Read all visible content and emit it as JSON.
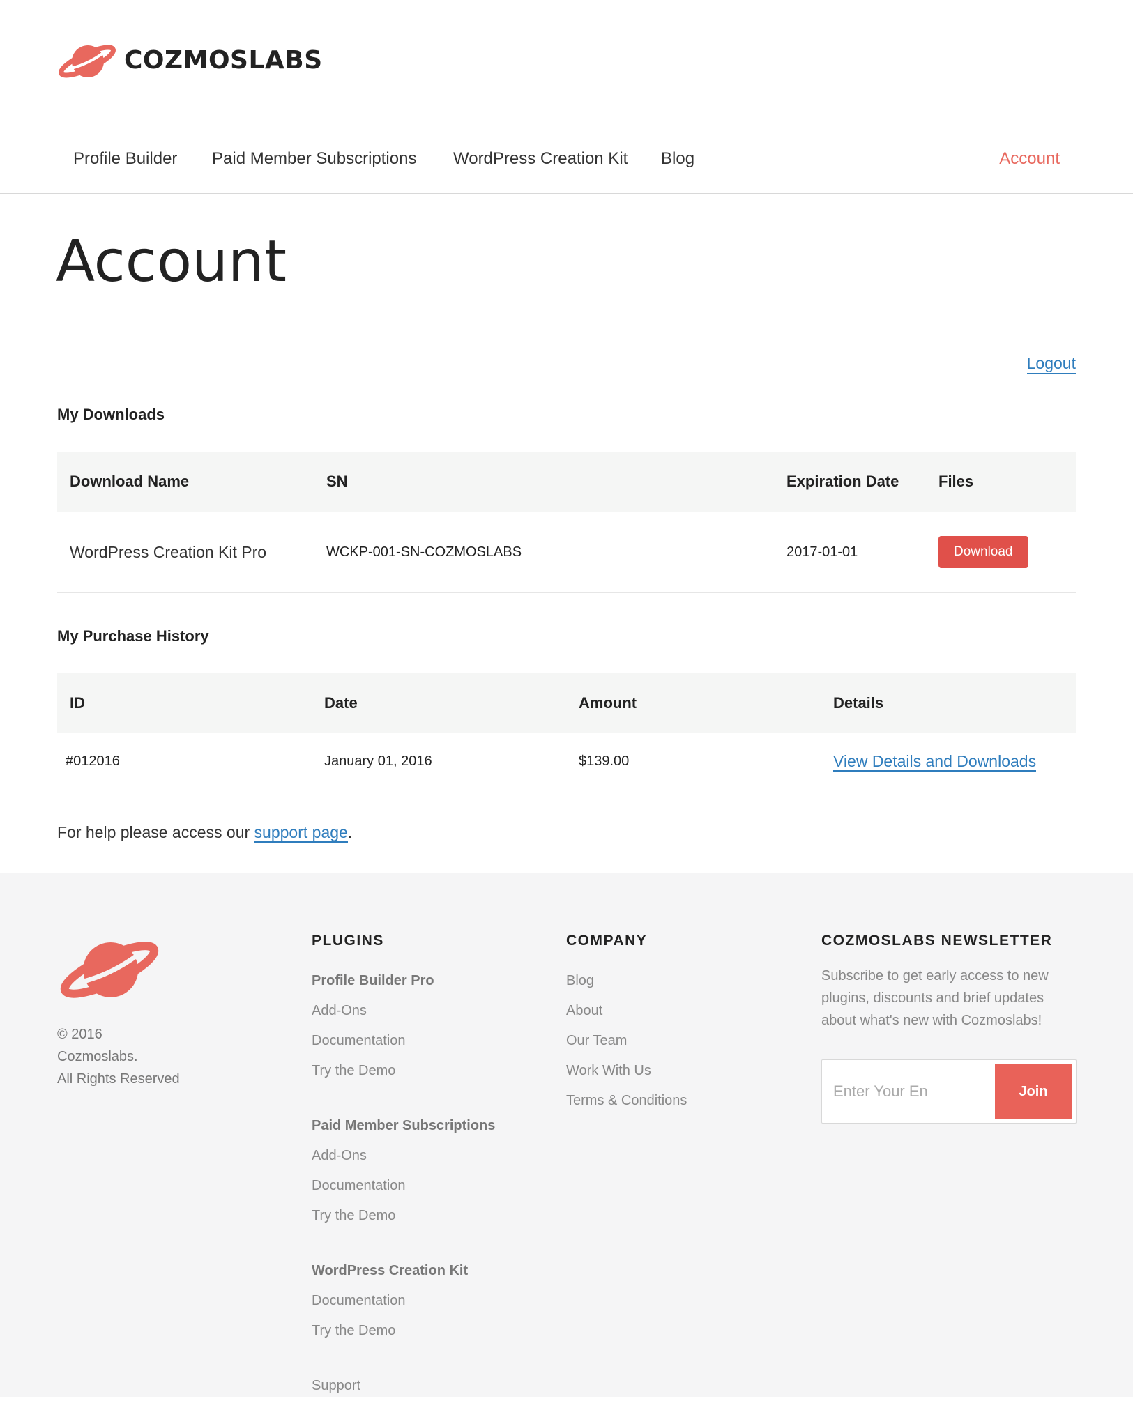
{
  "brand": {
    "name": "COZMOSLABS",
    "logo_color": "#e8685e"
  },
  "nav": {
    "items": [
      "Profile Builder",
      "Paid Member Subscriptions",
      "WordPress Creation Kit",
      "Blog"
    ],
    "account": "Account"
  },
  "page": {
    "title": "Account",
    "logout": "Logout"
  },
  "downloads": {
    "title": "My Downloads",
    "headers": [
      "Download Name",
      "SN",
      "Expiration Date",
      "Files"
    ],
    "rows": [
      {
        "name": "WordPress Creation Kit Pro",
        "sn": "WCKP-001-SN-COZMOSLABS",
        "expiration": "2017-01-01",
        "button": "Download"
      }
    ]
  },
  "purchases": {
    "title": "My Purchase History",
    "headers": [
      "ID",
      "Date",
      "Amount",
      "Details"
    ],
    "rows": [
      {
        "id": "#012016",
        "date": "January 01, 2016",
        "amount": "$139.00",
        "details": "View Details and Downloads"
      }
    ]
  },
  "help": {
    "prefix": "For help please access our ",
    "link": "support page",
    "suffix": "."
  },
  "footer": {
    "copyright": [
      "© 2016",
      "Cozmoslabs.",
      "All Rights Reserved"
    ],
    "plugins": {
      "heading": "PLUGINS",
      "groups": [
        {
          "title": "Profile Builder Pro",
          "links": [
            "Add-Ons",
            "Documentation",
            "Try the Demo"
          ]
        },
        {
          "title": "Paid Member Subscriptions",
          "links": [
            "Add-Ons",
            "Documentation",
            "Try the Demo"
          ]
        },
        {
          "title": "WordPress Creation Kit",
          "links": [
            "Documentation",
            "Try the Demo"
          ]
        }
      ],
      "support": "Support"
    },
    "company": {
      "heading": "COMPANY",
      "links": [
        "Blog",
        "About",
        "Our Team",
        "Work With Us",
        "Terms & Conditions"
      ]
    },
    "newsletter": {
      "heading": "COZMOSLABS NEWSLETTER",
      "text": "Subscribe to get early access to new plugins, discounts and brief updates about what's new with Cozmoslabs!",
      "placeholder": "Enter Your En",
      "button": "Join"
    }
  }
}
